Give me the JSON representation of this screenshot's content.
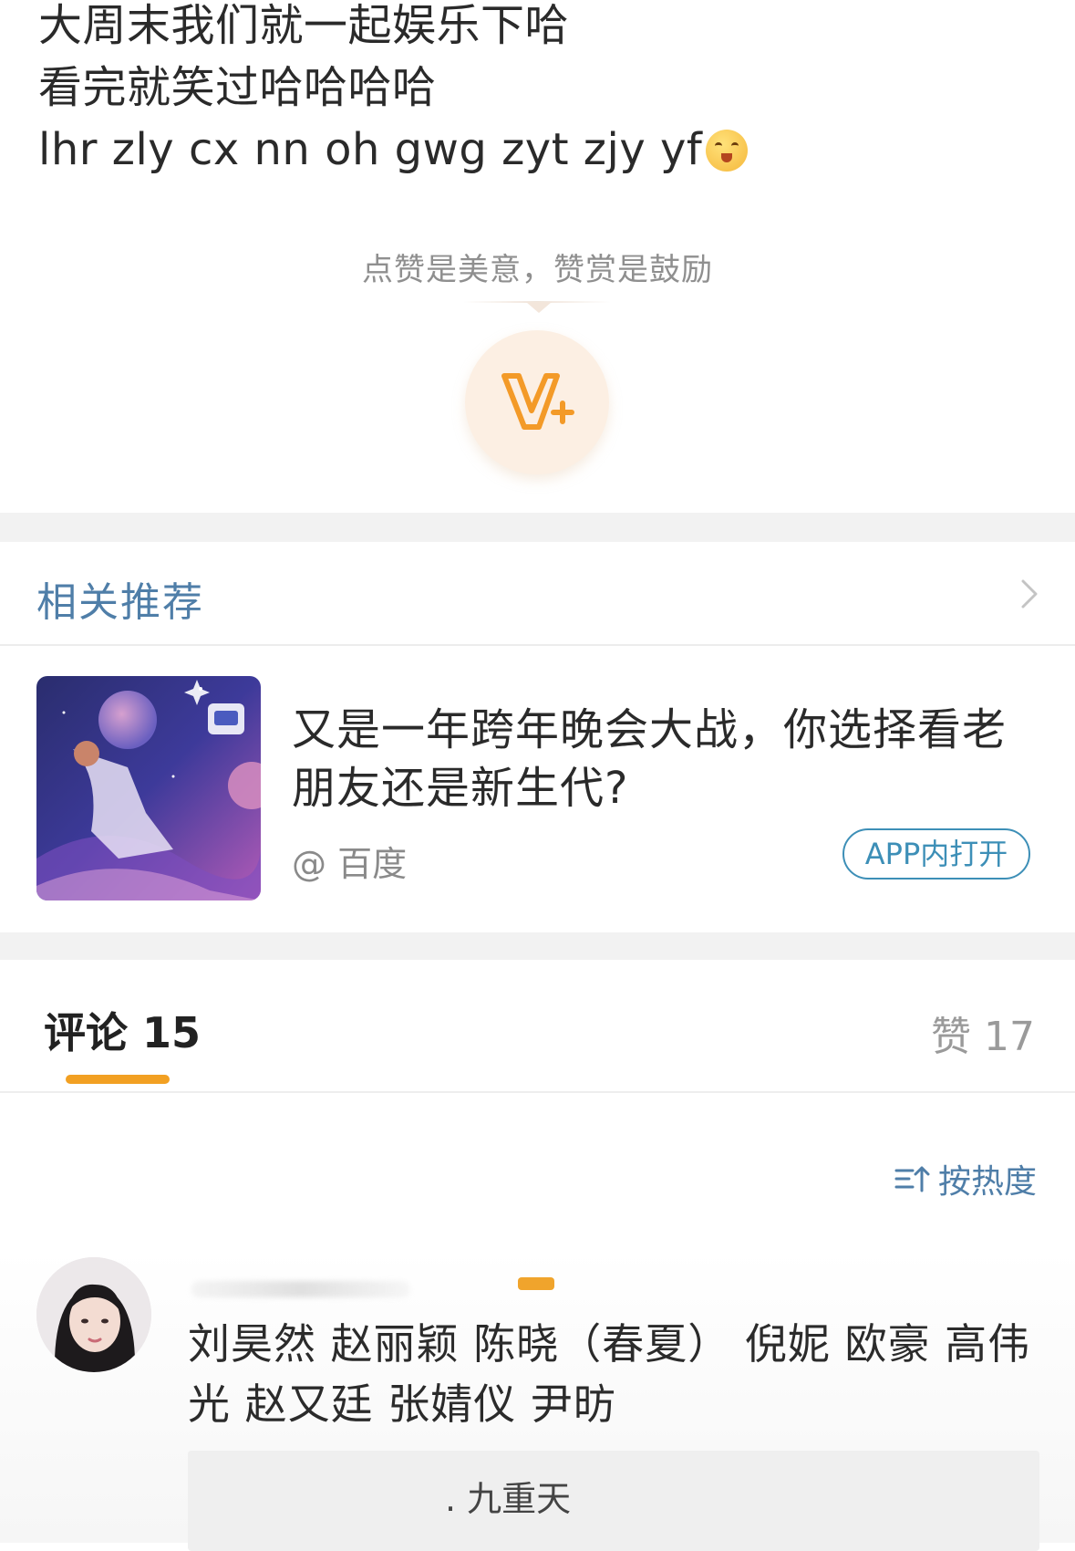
{
  "post": {
    "lines": [
      "大周末我们就一起娱乐下哈",
      "看完就笑过哈哈哈哈",
      "lhr zly cx nn oh gwg zyt zjy yf"
    ],
    "emoji_icon": "hugging-face-emoji"
  },
  "reward": {
    "hint": "点赞是美意，赞赏是鼓励",
    "icon": "v-plus-reward-icon",
    "accent": "#f39a28"
  },
  "related": {
    "title": "相关推荐",
    "chevron_icon": "chevron-right-icon",
    "card": {
      "title": "又是一年跨年晚会大战，你选择看老朋友还是新生代?",
      "source": "@ 百度",
      "open_app_label": "APP内打开"
    }
  },
  "comments_header": {
    "tab_label": "评论 15",
    "likes_label": "赞 17",
    "accent": "#f2a022"
  },
  "sort": {
    "label": "按热度",
    "icon": "sort-icon"
  },
  "comment": {
    "text": "刘昊然 赵丽颖 陈晓（春夏） 倪妮 欧豪 高伟光 赵又廷 张婧仪 尹昉",
    "reply_author": ". 九重天"
  }
}
